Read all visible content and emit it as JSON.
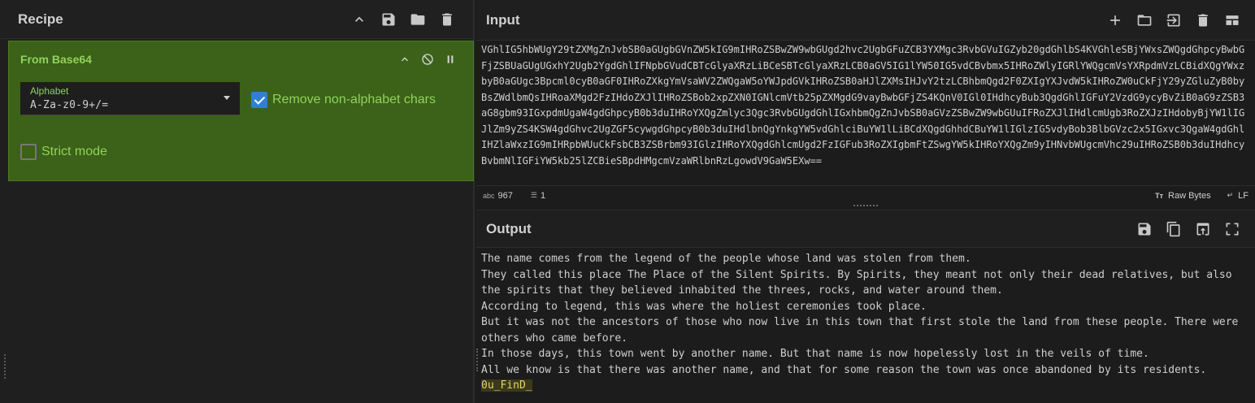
{
  "recipe": {
    "title": "Recipe",
    "operation": {
      "title": "From Base64",
      "alphabet_label": "Alphabet",
      "alphabet_value": "A-Za-z0-9+/=",
      "remove_nonalpha_label": "Remove non-alphabet chars",
      "remove_nonalpha_checked": true,
      "strict_mode_label": "Strict mode",
      "strict_mode_checked": false
    }
  },
  "input": {
    "title": "Input",
    "text": "VGhlIG5hbWUgY29tZXMgZnJvbSB0aGUgbGVnZW5kIG9mIHRoZSBwZW9wbGUgd2hvc2UgbGFuZCB3YXMgc3RvbGVuIGZyb20gdGhlbS4KVGhleSBjYWxsZWQgdGhpcyBwbGFjZSBUaGUgUGxhY2Ugb2YgdGhlIFNpbGVudCBTcGlyaXRzLiBCeSBTcGlyaXRzLCB0aGV5IG1lYW50IG5vdCBvbmx5IHRoZWlyIGRlYWQgcmVsYXRpdmVzLCBidXQgYWxzbyB0aGUgc3Bpcml0cyB0aGF0IHRoZXkgYmVsaWV2ZWQgaW5oYWJpdGVkIHRoZSB0aHJlZXMsIHJvY2tzLCBhbmQgd2F0ZXIgYXJvdW5kIHRoZW0uCkFjY29yZGluZyB0byBsZWdlbmQsIHRoaXMgd2FzIHdoZXJlIHRoZSBob2xpZXN0IGNlcmVtb25pZXMgdG9vayBwbGFjZS4KQnV0IGl0IHdhcyBub3QgdGhlIGFuY2VzdG9ycyBvZiB0aG9zZSB3aG8gbm93IGxpdmUgaW4gdGhpcyB0b3duIHRoYXQgZmlyc3Qgc3RvbGUgdGhlIGxhbmQgZnJvbSB0aGVzZSBwZW9wbGUuIFRoZXJlIHdlcmUgb3RoZXJzIHdobyBjYW1lIGJlZm9yZS4KSW4gdGhvc2UgZGF5cywgdGhpcyB0b3duIHdlbnQgYnkgYW5vdGhlciBuYW1lLiBCdXQgdGhhdCBuYW1lIGlzIG5vdyBob3BlbGVzc2x5IGxvc3QgaW4gdGhlIHZlaWxzIG9mIHRpbWUuCkFsbCB3ZSBrbm93IGlzIHRoYXQgdGhlcmUgd2FzIGFub3RoZXIgbmFtZSwgYW5kIHRoYXQgZm9yIHNvbWUgcmVhc29uIHRoZSB0b3duIHdhcyBvbmNlIGFiYW5kb25lZCBieSBpdHMgcmVzaWRlbnRzLgowdV9GaW5EXw==",
    "char_count_label": "967",
    "line_count_label": "1",
    "raw_bytes_label": "Raw Bytes",
    "eol_label": "LF"
  },
  "output": {
    "title": "Output",
    "lines": [
      "The name comes from the legend of the people whose land was stolen from them.",
      "They called this place The Place of the Silent Spirits. By Spirits, they meant not only their dead relatives, but also the spirits that they believed inhabited the threes, rocks, and water around them.",
      "According to legend, this was where the holiest ceremonies took place.",
      "But it was not the ancestors of those who now live in this town that first stole the land from these people. There were others who came before.",
      "In those days, this town went by another name. But that name is now hopelessly lost in the veils of time.",
      "All we know is that there was another name, and that for some reason the town was once abandoned by its residents."
    ],
    "highlight": "0u_FinD_"
  },
  "colors": {
    "op_bg": "#3c6119",
    "op_text": "#8fd45a",
    "checkbox_on": "#2f7fd6"
  }
}
